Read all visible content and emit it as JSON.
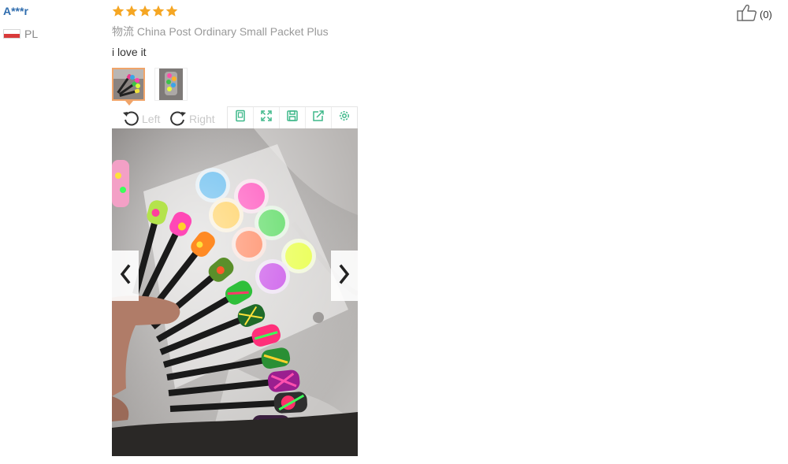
{
  "reviewer": {
    "name": "A***r",
    "country_code": "PL",
    "flag_colors": [
      "#ffffff",
      "#d93a3a"
    ]
  },
  "review": {
    "rating": 5,
    "rating_max": 5,
    "star_color": "#f5a623",
    "logistics_label": "物流",
    "logistics_value": "China Post Ordinary Small Packet Plus",
    "text": "i love it"
  },
  "photos": {
    "count": 2,
    "selected_index": 0,
    "selected_border_color": "#f0a469"
  },
  "viewer": {
    "rotate_left_label": "Left",
    "rotate_right_label": "Right",
    "toolbar_icons": [
      "phone-view-icon",
      "fullscreen-icon",
      "save-icon",
      "share-icon",
      "settings-icon"
    ],
    "toolbar_icon_color": "#3eb88a",
    "prev_icon": "chevron-left-icon",
    "next_icon": "chevron-right-icon"
  },
  "helpful": {
    "count_text": "(0)",
    "icon": "thumbs-up-icon"
  }
}
